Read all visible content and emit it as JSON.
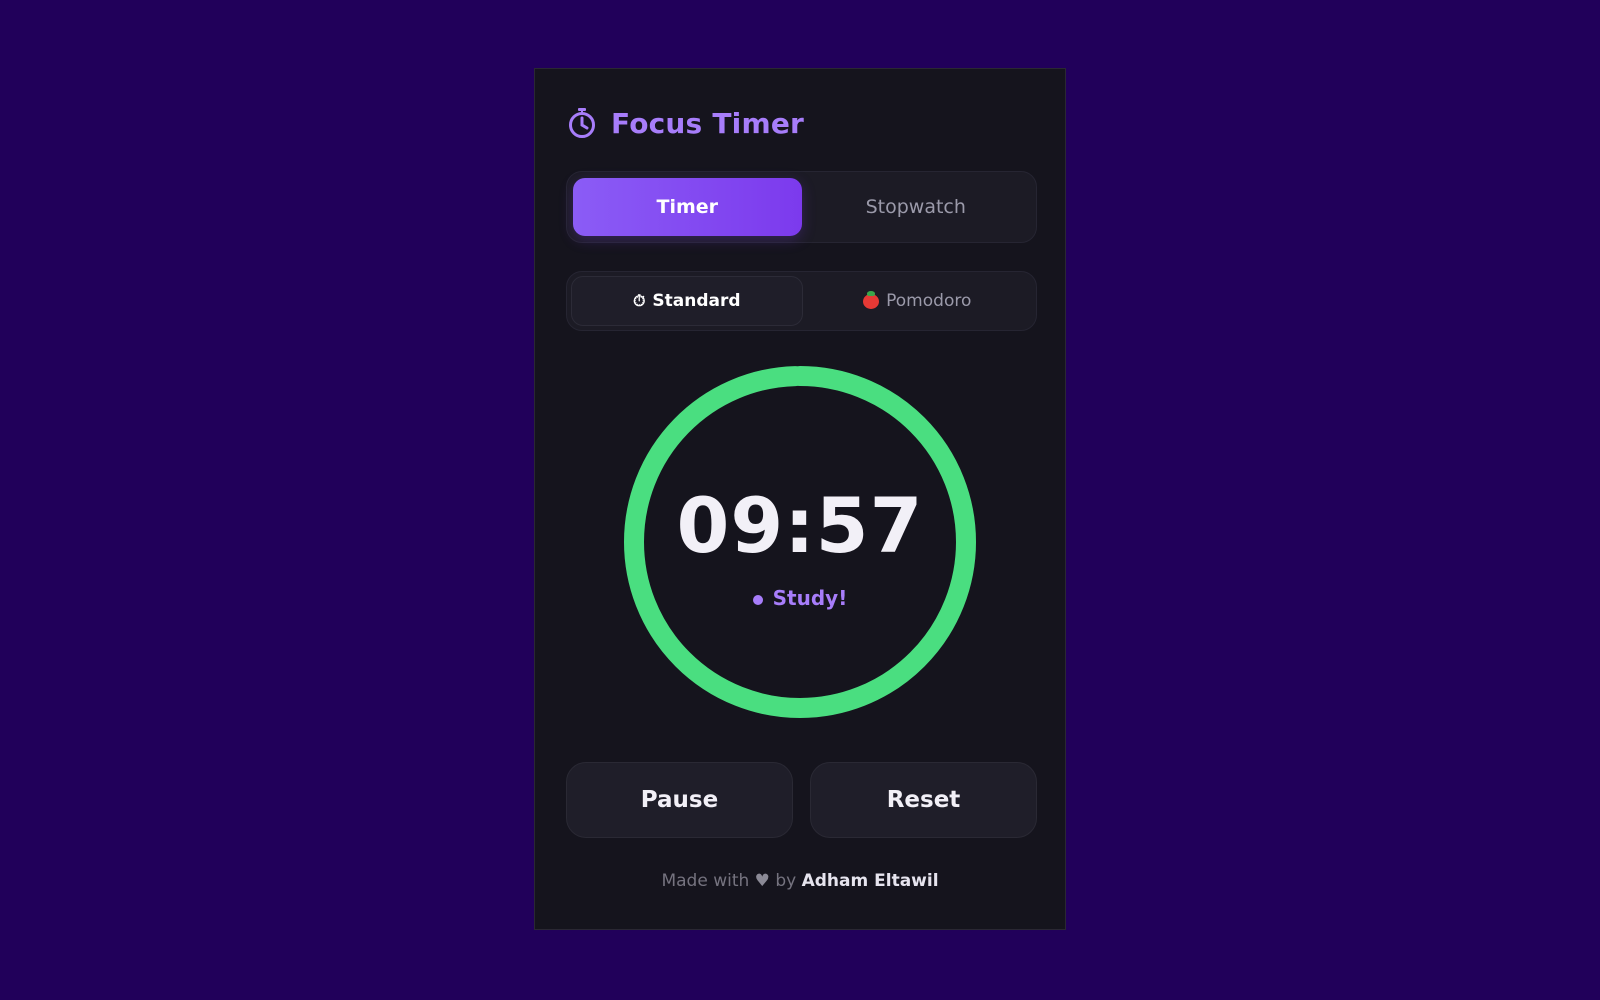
{
  "app": {
    "title": "Focus Timer",
    "icon": "stopwatch-icon"
  },
  "mode_tabs": [
    {
      "label": "Timer",
      "active": true
    },
    {
      "label": "Stopwatch",
      "active": false
    }
  ],
  "style_tabs": [
    {
      "icon": "⏱",
      "label": "Standard",
      "active": true
    },
    {
      "icon": "tomato-icon",
      "label": "Pomodoro",
      "active": false
    }
  ],
  "timer": {
    "display": "09:57",
    "status": "Study!",
    "progress": 0.995,
    "ring_color": "#4ade80"
  },
  "actions": {
    "pause_label": "Pause",
    "reset_label": "Reset"
  },
  "footer": {
    "made_with": "Made with",
    "heart": "♥",
    "by": "by",
    "author": "Adham Eltawil"
  },
  "colors": {
    "background": "#21005a",
    "panel": "#15141d",
    "accent": "#8b5cf6",
    "ring": "#4ade80"
  }
}
